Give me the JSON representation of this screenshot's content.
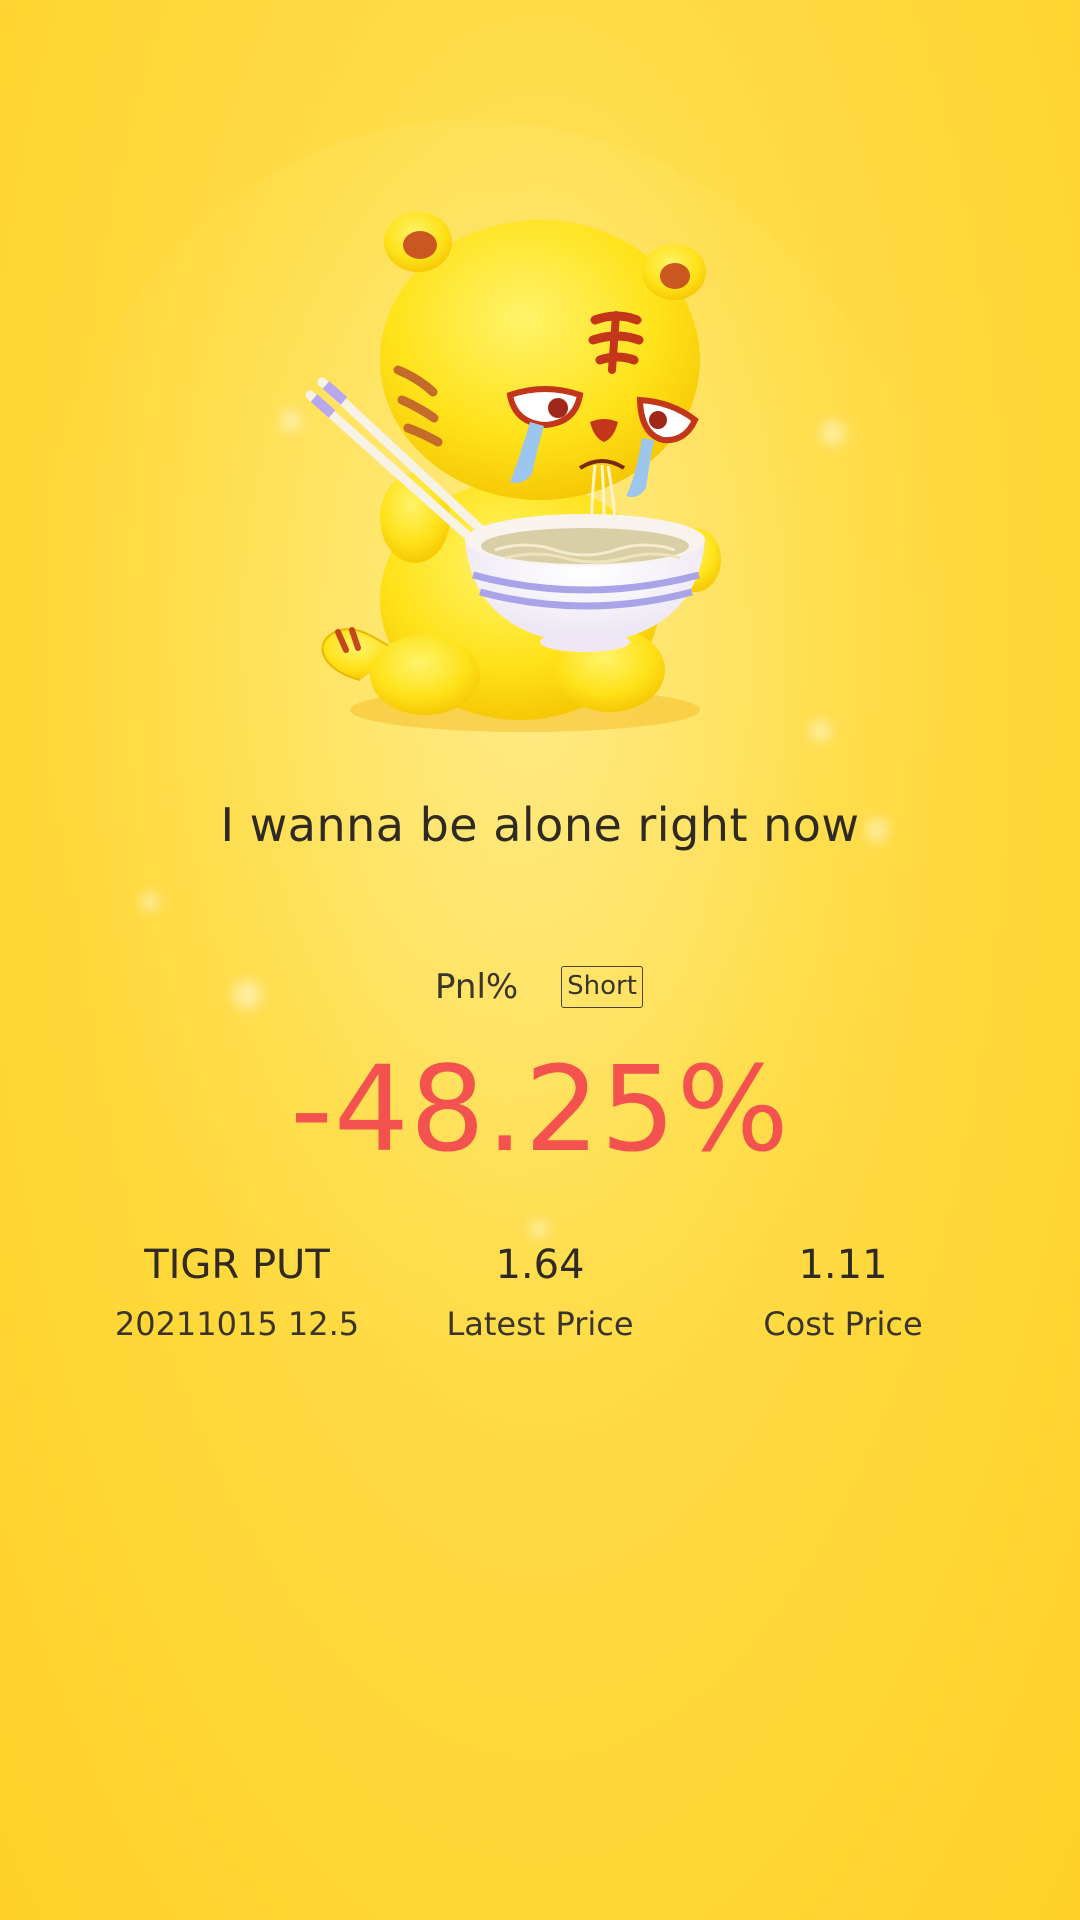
{
  "headline": "I wanna be alone right now",
  "pnl": {
    "label": "Pnl%",
    "direction": "Short",
    "value": "-48.25%"
  },
  "stats": [
    {
      "main": "TIGR PUT",
      "sub": "20211015 12.5"
    },
    {
      "main": "1.64",
      "sub": "Latest Price"
    },
    {
      "main": "1.11",
      "sub": "Cost Price"
    }
  ],
  "mascot": {
    "icon": "crying-tiger-eating-noodles-icon"
  },
  "colors": {
    "background": "#ffd633",
    "loss": "#f4524f",
    "text": "#2f2a22"
  }
}
